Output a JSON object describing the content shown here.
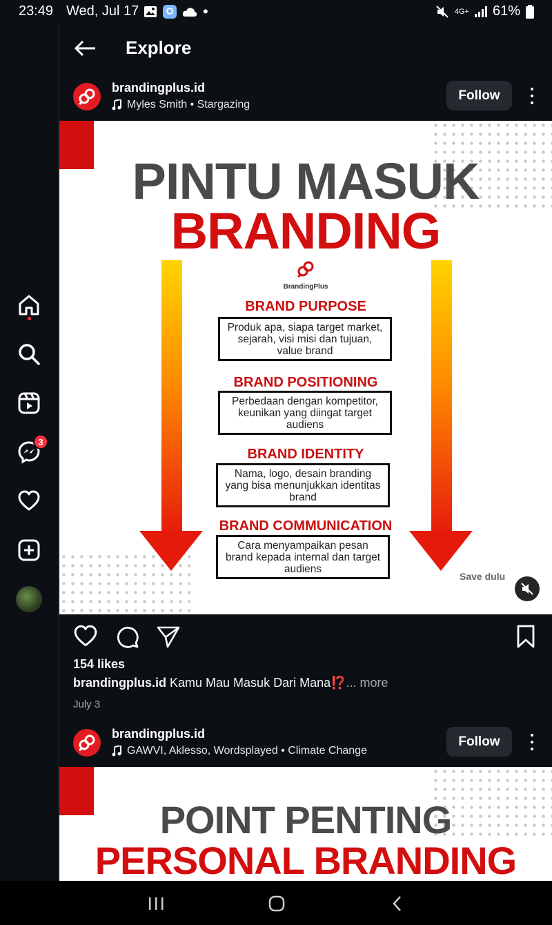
{
  "status_bar": {
    "time": "23:49",
    "date": "Wed, Jul 17",
    "network": "4G+",
    "battery": "61%"
  },
  "header": {
    "title": "Explore"
  },
  "rail": {
    "messages_badge": "3"
  },
  "posts": [
    {
      "username": "brandingplus.id",
      "audio": "Myles Smith • Stargazing",
      "follow_label": "Follow",
      "image": {
        "title_line1": "PINTU MASUK",
        "title_line2": "BRANDING",
        "logo_text": "BrandingPlus",
        "steps": [
          {
            "title": "BRAND PURPOSE",
            "text": "Produk apa, siapa target market, sejarah, visi misi dan tujuan, value brand"
          },
          {
            "title": "BRAND POSITIONING",
            "text": "Perbedaan dengan kompetitor, keunikan yang diingat target audiens"
          },
          {
            "title": "BRAND IDENTITY",
            "text": "Nama, logo, desain branding yang bisa menunjukkan identitas brand"
          },
          {
            "title": "BRAND COMMUNICATION",
            "text": "Cara menyampaikan pesan brand kepada internal dan target audiens"
          }
        ],
        "save_text": "Save dulu"
      },
      "likes": "154 likes",
      "caption_user": "brandingplus.id",
      "caption_text": "Kamu Mau Masuk Dari Mana",
      "caption_emoji": "⁉️",
      "caption_more": "... more",
      "date": "July 3"
    },
    {
      "username": "brandingplus.id",
      "audio": "GAWVI, Aklesso, Wordsplayed • Climate Change",
      "follow_label": "Follow",
      "image": {
        "title_line1": "POINT PENTING",
        "title_line2": "PERSONAL BRANDING"
      }
    }
  ],
  "colors": {
    "background": "#0c1014",
    "brand_red": "#d30e0e",
    "follow_button": "#262a30",
    "badge": "#ff3040"
  }
}
